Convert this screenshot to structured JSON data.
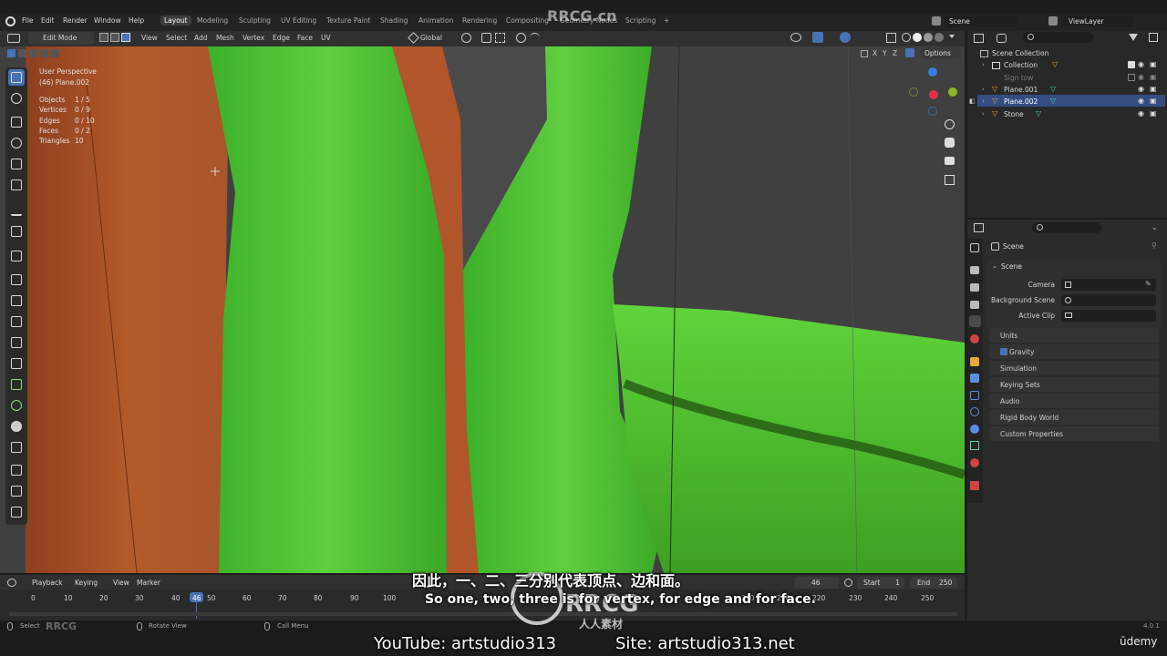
{
  "menu": [
    "File",
    "Edit",
    "Render",
    "Window",
    "Help"
  ],
  "workspaces": [
    "Layout",
    "Modeling",
    "Sculpting",
    "UV Editing",
    "Texture Paint",
    "Shading",
    "Animation",
    "Rendering",
    "Compositing",
    "Geometry Nodes",
    "Scripting"
  ],
  "active_workspace": "Layout",
  "scene_selector": "Scene",
  "viewlayer_selector": "ViewLayer",
  "header": {
    "mode": "Edit Mode",
    "menus": [
      "View",
      "Select",
      "Add",
      "Mesh",
      "Vertex",
      "Edge",
      "Face",
      "UV"
    ],
    "orientation": "Global",
    "options": "Options",
    "axes": [
      "X",
      "Y",
      "Z"
    ]
  },
  "viewport_overlay": {
    "perspective": "User Perspective",
    "object": "(46) Plane.002",
    "stats": [
      {
        "label": "Objects",
        "value": "1 / 5"
      },
      {
        "label": "Vertices",
        "value": "0 / 9"
      },
      {
        "label": "Edges",
        "value": "0 / 10"
      },
      {
        "label": "Faces",
        "value": "0 / 2"
      },
      {
        "label": "Triangles",
        "value": "10"
      }
    ]
  },
  "outliner": {
    "root": "Scene Collection",
    "items": [
      {
        "name": "Collection",
        "selected": false
      },
      {
        "name": "Sign tow",
        "selected": false
      },
      {
        "name": "Plane.001",
        "selected": false
      },
      {
        "name": "Plane.002",
        "selected": true
      },
      {
        "name": "Stone",
        "selected": false
      }
    ]
  },
  "properties": {
    "context": "Scene",
    "section": "Scene",
    "fields": [
      {
        "label": "Camera"
      },
      {
        "label": "Background Scene"
      },
      {
        "label": "Active Clip"
      }
    ],
    "panels": [
      "Units",
      "Gravity",
      "Simulation",
      "Keying Sets",
      "Audio",
      "Rigid Body World",
      "Custom Properties"
    ]
  },
  "timeline": {
    "menus": [
      "Playback",
      "Keying",
      "View",
      "Marker"
    ],
    "current_frame": "46",
    "start_label": "Start",
    "start": "1",
    "end_label": "End",
    "end": "250",
    "ticks": [
      "0",
      "10",
      "20",
      "30",
      "40",
      "46",
      "50",
      "60",
      "70",
      "80",
      "90",
      "100",
      "200",
      "210",
      "220",
      "230",
      "240",
      "250"
    ]
  },
  "statusbar": {
    "select": "Select",
    "rotate": "Rotate View",
    "call_menu": "Call Menu",
    "version": "4.0.1"
  },
  "subtitles": {
    "chinese": "因此，一、二、三分别代表顶点、边和面。",
    "english": "So one, two, three is for vertex, for edge and for face.",
    "youtube": "YouTube: artstudio313",
    "site": "Site: artstudio313.net"
  },
  "watermarks": {
    "rrcg": "RRCG",
    "rrcg_cn": "RRCG.cn",
    "renrensucai": "人人素材",
    "udemy": "ūdemy"
  },
  "colors": {
    "accent": "#4772b3",
    "green_mesh": "#45c12d",
    "orange_mesh": "#b85a2c"
  }
}
